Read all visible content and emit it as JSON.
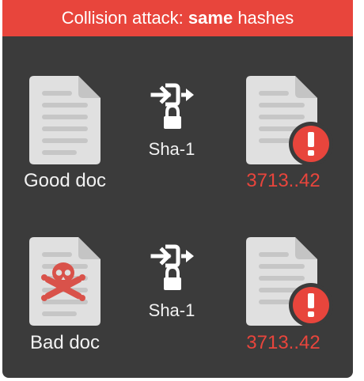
{
  "banner": {
    "prefix": "Collision attack: ",
    "emphasis": "same",
    "suffix": " hashes"
  },
  "rows": [
    {
      "input_label": "Good doc",
      "algorithm": "Sha-1",
      "hash": "3713..42",
      "input_marked_with": "none"
    },
    {
      "input_label": "Bad doc",
      "algorithm": "Sha-1",
      "hash": "3713..42",
      "input_marked_with": "skull-crossbones-icon"
    }
  ],
  "colors": {
    "banner": "#e8453c",
    "background": "#3b3b3b",
    "document": "#e0e0e0",
    "document_lines": "#c6c6c6",
    "alert": "#e8453c",
    "skull": "#d9524a",
    "hash_text": "#e8453c",
    "label_text": "#f2f2f2"
  }
}
